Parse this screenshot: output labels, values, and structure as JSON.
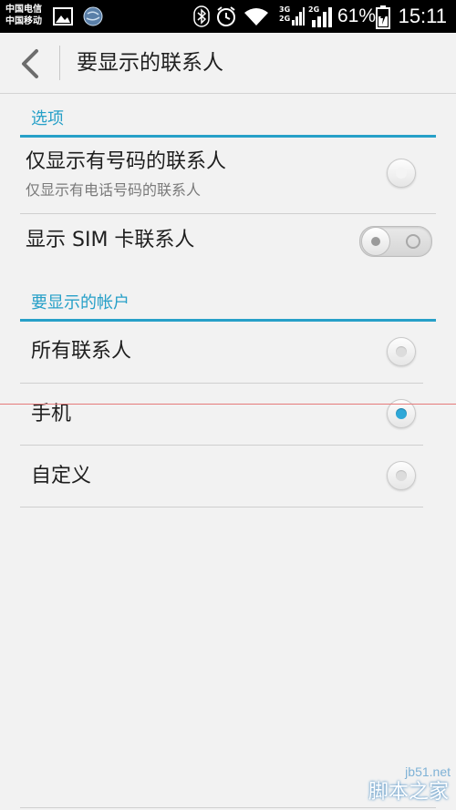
{
  "status_bar": {
    "carrier_1": "中国电信",
    "carrier_2": "中国移动",
    "network_1": "3G",
    "network_2": "2G",
    "network_3": "2G",
    "battery": "61%",
    "time": "15:11"
  },
  "action_bar": {
    "title": "要显示的联系人"
  },
  "sections": {
    "options_header": "选项",
    "accounts_header": "要显示的帐户"
  },
  "options": {
    "only_with_phone": {
      "title": "仅显示有号码的联系人",
      "subtitle": "仅显示有电话号码的联系人",
      "checked": false
    },
    "show_sim": {
      "title": "显示 SIM 卡联系人",
      "enabled": false
    }
  },
  "accounts": [
    {
      "label": "所有联系人",
      "selected": false
    },
    {
      "label": "手机",
      "selected": true
    },
    {
      "label": "自定义",
      "selected": false
    }
  ],
  "watermark": {
    "url": "jb51.net",
    "text": "脚本之家"
  },
  "colors": {
    "accent": "#27a0c8",
    "radio_selected": "#2fa8d8"
  }
}
